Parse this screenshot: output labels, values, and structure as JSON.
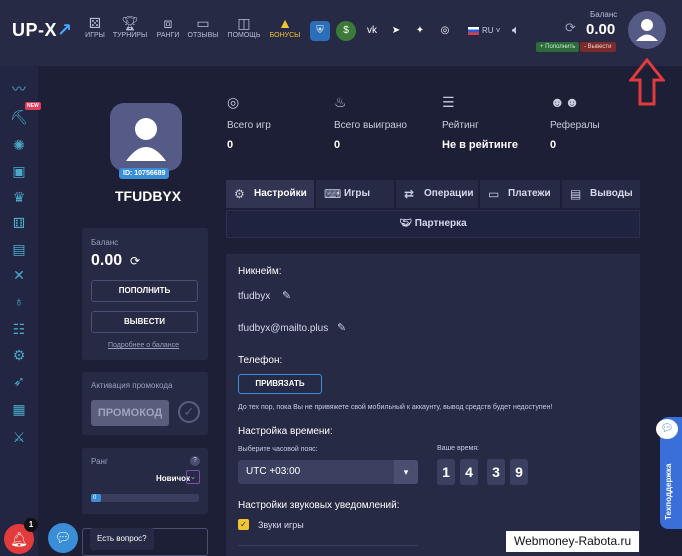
{
  "header": {
    "logo": "UP-X",
    "nav": [
      {
        "label": "ИГРЫ",
        "icon": "dice-icon"
      },
      {
        "label": "ТУРНИРЫ",
        "icon": "trophy-icon"
      },
      {
        "label": "РАНГИ",
        "icon": "rank-icon"
      },
      {
        "label": "ОТЗЫВЫ",
        "icon": "reviews-icon"
      },
      {
        "label": "ПОМОЩЬ",
        "icon": "help-icon"
      },
      {
        "label": "БОНУСЫ",
        "icon": "bonus-icon"
      }
    ],
    "socials": [
      "shield-icon",
      "dollar-icon",
      "vk-icon",
      "telegram-icon",
      "twitter-icon",
      "instagram-icon"
    ],
    "language": "RU",
    "balance_label": "Баланс",
    "balance_value": "0.00",
    "deposit_label": "+ Пополнить",
    "withdraw_label": "- Вывести",
    "colors": {
      "bonus": "#f4c431",
      "accent": "#3a8ed8",
      "arrow": "#e23b3b"
    }
  },
  "sidebar": {
    "new_badge": "NEW",
    "icons": [
      "trend-icon",
      "mining-icon",
      "wheel-icon",
      "case-icon",
      "crown-icon",
      "dice-icon",
      "cards-icon",
      "x-icon",
      "bomb-icon",
      "ladder-icon",
      "gear-icon",
      "keno-icon",
      "rocket-icon",
      "swords-icon"
    ]
  },
  "profile": {
    "id": "ID: 10756689",
    "username": "TFUDBYX"
  },
  "balance_card": {
    "label": "Баланс",
    "value": "0.00",
    "deposit_button": "ПОПОЛНИТЬ",
    "withdraw_button": "ВЫВЕСТИ",
    "details_link": "Подробнее о балансе"
  },
  "promo_card": {
    "label": "Активация промокода",
    "button": "ПРОМОКОД"
  },
  "rank_card": {
    "label": "Ранг",
    "help": "?",
    "rank_name": "Новичок",
    "progress": 0,
    "progress_label": "0"
  },
  "stats": [
    {
      "label": "Всего игр",
      "value": "0",
      "icon": "games-icon"
    },
    {
      "label": "Всего выиграно",
      "value": "0",
      "icon": "winnings-icon"
    },
    {
      "label": "Рейтинг",
      "value": "Не в рейтинге",
      "icon": "rating-icon"
    },
    {
      "label": "Рефералы",
      "value": "0",
      "icon": "referrals-icon"
    }
  ],
  "tabs": [
    {
      "label": "Настройки",
      "icon": "gear-icon"
    },
    {
      "label": "Игры",
      "icon": "gamepad-icon"
    },
    {
      "label": "Операции",
      "icon": "operations-icon"
    },
    {
      "label": "Платежи",
      "icon": "card-icon"
    },
    {
      "label": "Выводы",
      "icon": "wallet-icon"
    },
    {
      "label": "Партнерка",
      "icon": "handshake-icon"
    }
  ],
  "settings": {
    "nickname_heading": "Никнейм:",
    "nickname_value": "tfudbyx",
    "email_value": "tfudbyx@mailto.plus",
    "phone_heading": "Телефон:",
    "bind_button": "ПРИВЯЗАТЬ",
    "phone_note": "До тех пор, пока Вы не привяжете свой мобильный к аккаунту, вывод средств будет недоступен!",
    "time_heading": "Настройка времени:",
    "tz_label": "Выберите часовой пояс:",
    "tz_value": "UTC +03:00",
    "your_time_label": "Ваше время:",
    "time_digits": [
      "1",
      "4",
      "3",
      "9"
    ],
    "sound_heading": "Настройки звуковых уведомлений:",
    "sound_option": "Звуки игры",
    "sound_checked": true
  },
  "floating": {
    "support_tab": "Техподдержка",
    "notification_count": "1",
    "chat_tooltip": "Есть вопрос?"
  },
  "watermark": "Webmoney-Rabota.ru"
}
